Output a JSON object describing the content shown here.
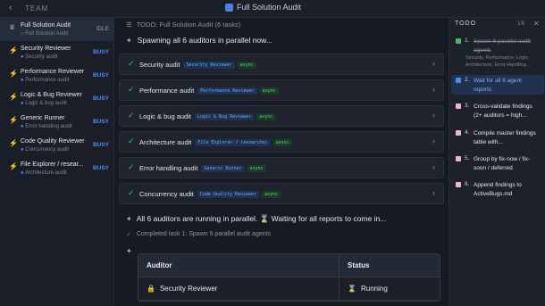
{
  "topbar": {
    "back_icon": "‹",
    "team_label": "TEAM",
    "window_title": "Full Solution Audit"
  },
  "sidebar": {
    "agents": [
      {
        "name": "Full Solution Audit",
        "sub": "Full Solution Audit",
        "status": "IDLE"
      },
      {
        "name": "Security Reviewer",
        "sub": "Security audit",
        "status": "BUSY"
      },
      {
        "name": "Performance Reviewer",
        "sub": "Performance audit",
        "status": "BUSY"
      },
      {
        "name": "Logic & Bug Reviewer",
        "sub": "Logic & bug audit",
        "status": "BUSY"
      },
      {
        "name": "Generic Runner",
        "sub": "Error handling audit",
        "status": "BUSY"
      },
      {
        "name": "Code Quality Reviewer",
        "sub": "Concurrency audit",
        "status": "BUSY"
      },
      {
        "name": "File Explorer / resear...",
        "sub": "Architecture audit",
        "status": "BUSY"
      }
    ]
  },
  "main": {
    "todo_header": "TODO: Full Solution Audit (6 tasks)",
    "spawn_text": "Spawning all 6 auditors in parallel now...",
    "tasks": [
      {
        "name": "Security audit",
        "agent": "Security Reviewer",
        "mode": "async"
      },
      {
        "name": "Performance audit",
        "agent": "Performance Reviewer",
        "mode": "async"
      },
      {
        "name": "Logic & bug audit",
        "agent": "Logic & Bug Reviewer",
        "mode": "async"
      },
      {
        "name": "Architecture audit",
        "agent": "File Explorer / researcher",
        "mode": "async"
      },
      {
        "name": "Error handling audit",
        "agent": "Generic Runner",
        "mode": "async"
      },
      {
        "name": "Concurrency audit",
        "agent": "Code Quality Reviewer",
        "mode": "async"
      }
    ],
    "running_text": "All 6 auditors are running in parallel. ⌛ Waiting for all reports to come in...",
    "completed_text": "Completed task 1: Spawn 6 parallel audit agents",
    "table": {
      "headers": [
        "Auditor",
        "Status"
      ],
      "rows": [
        {
          "auditor": "Security Reviewer",
          "status": "Running"
        }
      ]
    }
  },
  "todo_panel": {
    "title": "TODO",
    "count": "1/6",
    "items": [
      {
        "num": "1.",
        "text": "Spawn 6 parallel audit agents",
        "sub": "Security, Performance, Logic, Architecture, Error Handling...",
        "state": "done"
      },
      {
        "num": "2.",
        "text": "Wait for all 6 agent reports",
        "state": "active"
      },
      {
        "num": "3.",
        "text": "Cross-validate findings (2+ auditors = high...",
        "state": "pending"
      },
      {
        "num": "4.",
        "text": "Compile master findings table with...",
        "state": "pending"
      },
      {
        "num": "5.",
        "text": "Group by fix-now / fix-soon / deferred",
        "state": "pending"
      },
      {
        "num": "6.",
        "text": "Append findings to ActiveBugs.md",
        "state": "pending"
      }
    ]
  },
  "colors": {
    "accent": "#4c8bf5",
    "success": "#3fbf6a",
    "pending": "#f0b6d0"
  }
}
